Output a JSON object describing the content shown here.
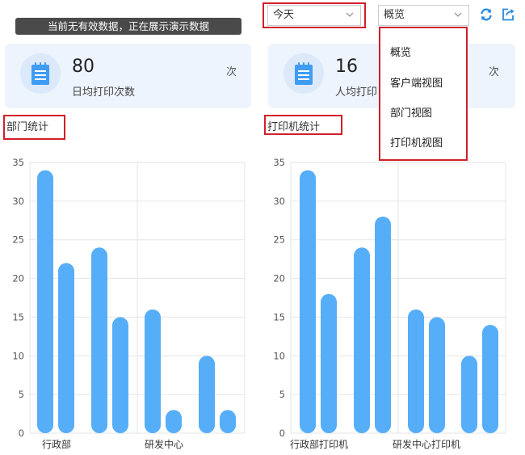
{
  "banner": {
    "text": "当前无有效数据，正在展示演示数据"
  },
  "filters": {
    "period": {
      "value": "今天"
    },
    "view": {
      "value": "概览"
    }
  },
  "view_menu": {
    "options": [
      "概览",
      "客户端视图",
      "部门视图",
      "打印机视图"
    ]
  },
  "toolbar": {
    "refresh_icon": "refresh-icon",
    "export_icon": "export-icon"
  },
  "colors": {
    "bar": "#57aef8",
    "highlight": "#d0202a",
    "card_bg": "#edf4fd"
  },
  "cards": [
    {
      "value": "80",
      "label": "日均打印次数",
      "unit": "次",
      "icon": "notepad-icon"
    },
    {
      "value": "16",
      "label": "人均打印",
      "unit": "次",
      "icon": "notepad-icon"
    }
  ],
  "sections": [
    {
      "title": "部门统计"
    },
    {
      "title": "打印机统计"
    }
  ],
  "chart_data": [
    {
      "type": "bar",
      "title": "部门统计",
      "ylim": [
        0,
        35
      ],
      "yticks": [
        0,
        5,
        10,
        15,
        20,
        25,
        30,
        35
      ],
      "xtick_labels": [
        "行政部",
        "研发中心"
      ],
      "grid": true,
      "values": [
        34,
        22,
        24,
        15,
        16,
        3,
        10,
        3
      ]
    },
    {
      "type": "bar",
      "title": "打印机统计",
      "ylim": [
        0,
        35
      ],
      "yticks": [
        0,
        5,
        10,
        15,
        20,
        25,
        30,
        35
      ],
      "xtick_labels": [
        "行政部打印机",
        "研发中心打印机"
      ],
      "grid": true,
      "values": [
        34,
        18,
        24,
        28,
        16,
        15,
        10,
        14
      ]
    }
  ]
}
